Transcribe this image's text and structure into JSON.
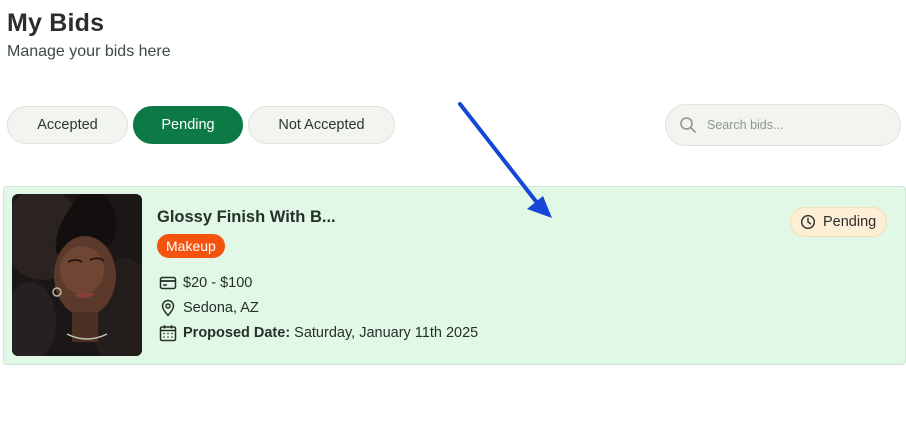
{
  "header": {
    "title": "My Bids",
    "subtitle": "Manage your bids here"
  },
  "tabs": [
    {
      "label": "Accepted",
      "active": false
    },
    {
      "label": "Pending",
      "active": true
    },
    {
      "label": "Not Accepted",
      "active": false
    }
  ],
  "search": {
    "placeholder": "Search bids...",
    "icon": "search-icon"
  },
  "bid": {
    "title": "Glossy Finish With B...",
    "category": "Makeup",
    "price_range": "$20 - $100",
    "location": "Sedona, AZ",
    "proposed_date_label": "Proposed Date:",
    "proposed_date": "Saturday, January 11th 2025",
    "status": "Pending",
    "status_icon": "clock-icon"
  },
  "colors": {
    "accent_green": "#0b7a44",
    "card_background": "#e0f8e5",
    "category_badge": "#f3530e",
    "status_badge": "#fcefd6",
    "annotation_arrow": "#1646d8"
  }
}
